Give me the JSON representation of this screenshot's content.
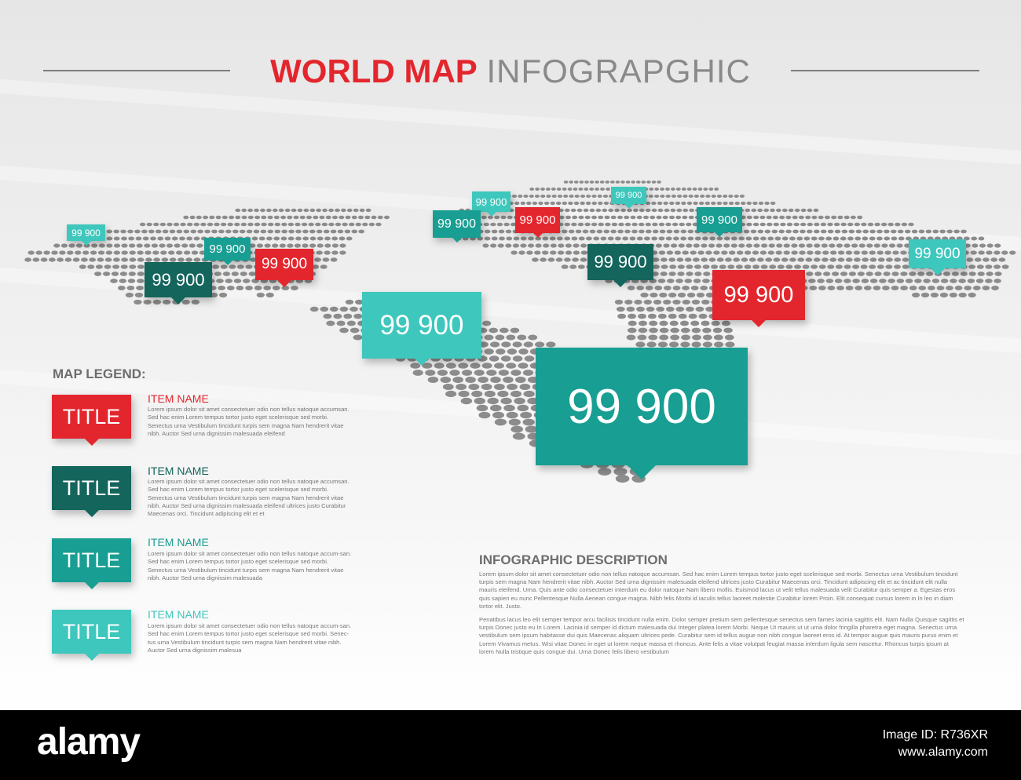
{
  "colors": {
    "red": "#e3262d",
    "dark_teal": "#14655c",
    "teal": "#189e92",
    "light_teal": "#3ec7bc"
  },
  "header": {
    "title_bold": "WORLD MAP",
    "title_light": "INFOGRAPGHIC"
  },
  "map_pins": [
    {
      "label": "99 900",
      "color": "light_teal"
    },
    {
      "label": "99 900",
      "color": "teal"
    },
    {
      "label": "99 900",
      "color": "dark_teal"
    },
    {
      "label": "99 900",
      "color": "red"
    },
    {
      "label": "99 900",
      "color": "light_teal"
    },
    {
      "label": "99 900",
      "color": "teal"
    },
    {
      "label": "99 900",
      "color": "red"
    },
    {
      "label": "99 900",
      "color": "light_teal"
    },
    {
      "label": "99 900",
      "color": "teal"
    },
    {
      "label": "99 900",
      "color": "dark_teal"
    },
    {
      "label": "99 900",
      "color": "red"
    },
    {
      "label": "99 900",
      "color": "light_teal"
    },
    {
      "label": "99 900",
      "color": "light_teal"
    },
    {
      "label": "99 900",
      "color": "teal"
    }
  ],
  "legend": {
    "heading": "MAP LEGEND:",
    "items": [
      {
        "badge": "TITLE",
        "color": "red",
        "name": "ITEM NAME",
        "text": "Lorem ipsum dolor sit amet consectetuer odio non tellus natoque accumsan. Sed hac enim Lorem tempus tortor justo eget scelerisque sed morbi. Senectus urna Vestibulum tincidunt turpis sem magna Nam hendrerit vitae nibh. Auctor Sed urna dignissim malesuada eleifend"
      },
      {
        "badge": "TITLE",
        "color": "dark_teal",
        "name": "ITEM NAME",
        "text": "Lorem ipsum dolor sit amet consectetuer odio non tellus natoque accumsan. Sed hac enim Lorem tempus tortor justo eget scelerisque sed morbi. Senectus urna Vestibulum tincidunt turpis sem magna Nam hendrerit vitae nibh. Auctor Sed urna dignissim malesuada eleifend ultrices justo Curabitur Maecenas orci. Tincidunt adipiscing elit et et"
      },
      {
        "badge": "TITLE",
        "color": "teal",
        "name": "ITEM NAME",
        "text": "Lorem ipsum dolor sit amet consectetuer odio non tellus natoque accum-san. Sed hac enim Lorem tempus tortor justo eget scelerisque sed morbi. Senectus urna Vestibulum tincidunt turpis sem magna Nam hendrerit vitae nibh. Auctor Sed urna dignissim malesuada"
      },
      {
        "badge": "TITLE",
        "color": "light_teal",
        "name": "ITEM NAME",
        "text": "Lorem ipsum dolor sit amet consectetuer odio non tellus natoque accum-san. Sed hac enim Lorem tempus tortor justo eget scelerisque sed morbi. Senec-tus urna Vestibulum tincidunt turpis sem magna Nam hendrerit vitae nibh. Auctor Sed urna dignissim malesua"
      }
    ]
  },
  "description": {
    "heading": "INFOGRAPHIC DESCRIPTION",
    "paragraphs": [
      "Lorem ipsum dolor sit amet consectetuer odio non tellus natoque accumsan. Sed hac enim Lorem tempus tortor justo eget scelerisque sed morbi. Senectus urna Vestibulum tincidunt turpis sem magna Nam hendrerit vitae nibh. Auctor Sed urna dignissim malesuada eleifend ultrices justo Curabitur Maecenas orci. Tincidunt adipiscing elit et ac tincidunt elit nulla mauris eleifend. Urna. Quis ante odio consectetuer interdum eu dolor natoque Nam libero mollis. Euismod lacus ut velit tellus malesuada velit Curabitur quis semper a. Egestas eros quis sapien eu nunc Pellentesque Nulla Aenean congue magna. Nibh felis Morbi id iaculis tellus laoreet molestie Curabitur lorem Proin. Elit consequat cursus lorem in In leo in diam tortor elit. Justo.",
      "Penatibus lacus leo elit semper tempor arcu facilisis tincidunt nulla enim. Dolor semper pretium sem pellentesque senectus sem fames lacinia sagittis elit. Nam Nulla Quisque sagittis et turpis Donec justo eu In Lorem. Lacinia id semper id dictum malesuada dui Integer platea lorem Morbi. Neque Ut mauris ut ut urna dolor fringilla pharetra eget magna. Senectus urna vestibulum sem ipsum habitasse dui quis Maecenas aliquam ultrices pede. Curabitur sem id tellus augue non nibh congue laoreet eros id. At tempor augue quis mauris purus enim et Lorem Vivamus metus. Wisi vitae Donec in eget ut lorem neque massa et rhoncus. Ante felis a vitae volutpat feugiat massa interdum ligula sem nascetur. Rhoncus turpis ipsum at lorem Nulla tristique quis congue dui. Urna Donec felis libero vestibulum"
    ]
  },
  "stock_bar": {
    "logo": "alamy",
    "image_id": "Image ID: R736XR",
    "url": "www.alamy.com"
  }
}
